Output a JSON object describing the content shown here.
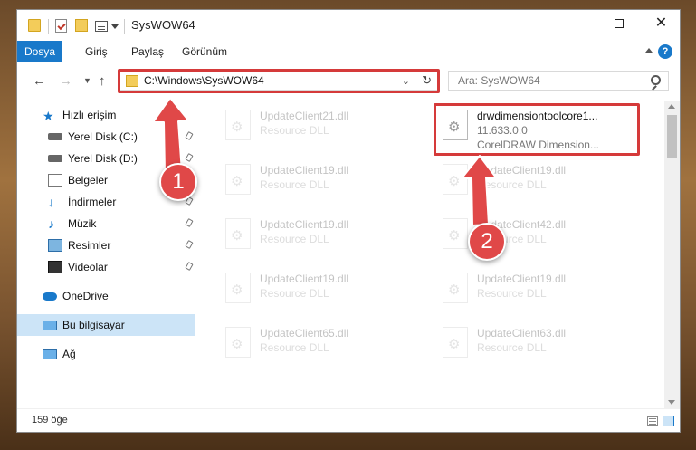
{
  "window": {
    "title": "SysWOW64"
  },
  "ribbon": {
    "tabs": [
      "Dosya",
      "Giriş",
      "Paylaş",
      "Görünüm"
    ],
    "help": "?"
  },
  "address": {
    "path": "C:\\Windows\\SysWOW64",
    "search_placeholder": "Ara: SysWOW64"
  },
  "sidebar": {
    "items": [
      {
        "label": "Hızlı erişim",
        "icon": "star-icon"
      },
      {
        "label": "Yerel Disk (C:)",
        "icon": "drive-icon"
      },
      {
        "label": "Yerel Disk (D:)",
        "icon": "drive-icon"
      },
      {
        "label": "Belgeler",
        "icon": "documents-icon"
      },
      {
        "label": "İndirmeler",
        "icon": "download-icon"
      },
      {
        "label": "Müzik",
        "icon": "music-icon"
      },
      {
        "label": "Resimler",
        "icon": "pictures-icon"
      },
      {
        "label": "Videolar",
        "icon": "videos-icon"
      },
      {
        "label": "OneDrive",
        "icon": "cloud-icon"
      },
      {
        "label": "Bu bilgisayar",
        "icon": "computer-icon"
      },
      {
        "label": "Ağ",
        "icon": "network-icon"
      }
    ]
  },
  "files": [
    {
      "name": "UpdateClient21.dll",
      "type": "Resource DLL"
    },
    {
      "name": "drwdimensiontoolcore1...",
      "version": "11.633.0.0",
      "desc": "CorelDRAW Dimension..."
    },
    {
      "name": "UpdateClient19.dll",
      "type": "Resource DLL"
    },
    {
      "name": "UpdateClient19.dll",
      "type": "Resource DLL"
    },
    {
      "name": "UpdateClient19.dll",
      "type": "Resource DLL"
    },
    {
      "name": "UpdateClient42.dll",
      "type": "Resource DLL"
    },
    {
      "name": "UpdateClient19.dll",
      "type": "Resource DLL"
    },
    {
      "name": "UpdateClient19.dll",
      "type": "Resource DLL"
    },
    {
      "name": "UpdateClient65.dll",
      "type": "Resource DLL"
    },
    {
      "name": "UpdateClient63.dll",
      "type": "Resource DLL"
    }
  ],
  "status": {
    "count": "159 öğe"
  },
  "annotations": {
    "step1": "1",
    "step2": "2",
    "accent": "#e04848"
  }
}
